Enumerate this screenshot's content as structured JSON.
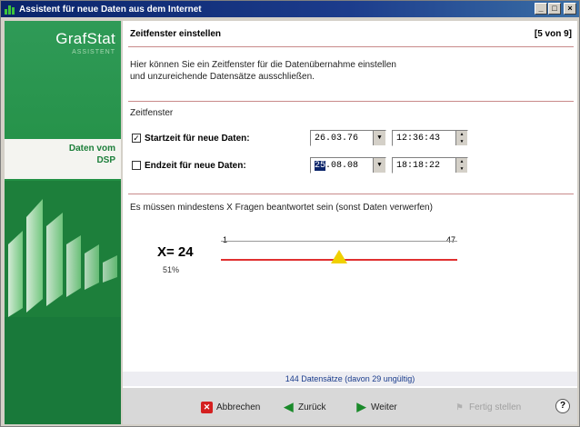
{
  "window": {
    "title": "Assistent für neue Daten aus dem Internet",
    "buttons": {
      "minimize": "_",
      "maximize": "□",
      "close": "×"
    }
  },
  "sidebar": {
    "brand": "GrafStat",
    "brand_sub": "ASSISTENT",
    "step_line1": "Daten vom",
    "step_line2": "DSP"
  },
  "header": {
    "title": "Zeitfenster einstellen",
    "page": "[5 von 9]"
  },
  "description": {
    "line1": "Hier können Sie ein Zeitfenster für die Datenübernahme einstellen",
    "line2": "und unzureichende Datensätze ausschließen."
  },
  "zeitfenster": {
    "section_label": "Zeitfenster",
    "start": {
      "checked": true,
      "check_glyph": "✓",
      "label": "Startzeit für neue Daten:",
      "date": "26.03.76",
      "time": "12:36:43"
    },
    "end": {
      "checked": false,
      "check_glyph": "",
      "label": "Endzeit für neue Daten:",
      "date_selected": "25",
      "date_rest": ".08.08",
      "time": "18:18:22"
    }
  },
  "fragen": {
    "section_label": "Es müssen mindestens X Fragen beantwortet sein (sonst Daten verwerfen)",
    "x_label": "X= 24",
    "percent": "51%",
    "slider_min": "1",
    "slider_max": "47",
    "slider_value": 24
  },
  "status": "144 Datensätze (davon 29 ungültig)",
  "buttons": {
    "cancel": "Abbrechen",
    "back": "Zurück",
    "next": "Weiter",
    "finish": "Fertig stellen",
    "help": "?"
  },
  "colors": {
    "sidebar_green": "#239045",
    "slider_line": "#e03030",
    "thumb": "#f0d000"
  }
}
